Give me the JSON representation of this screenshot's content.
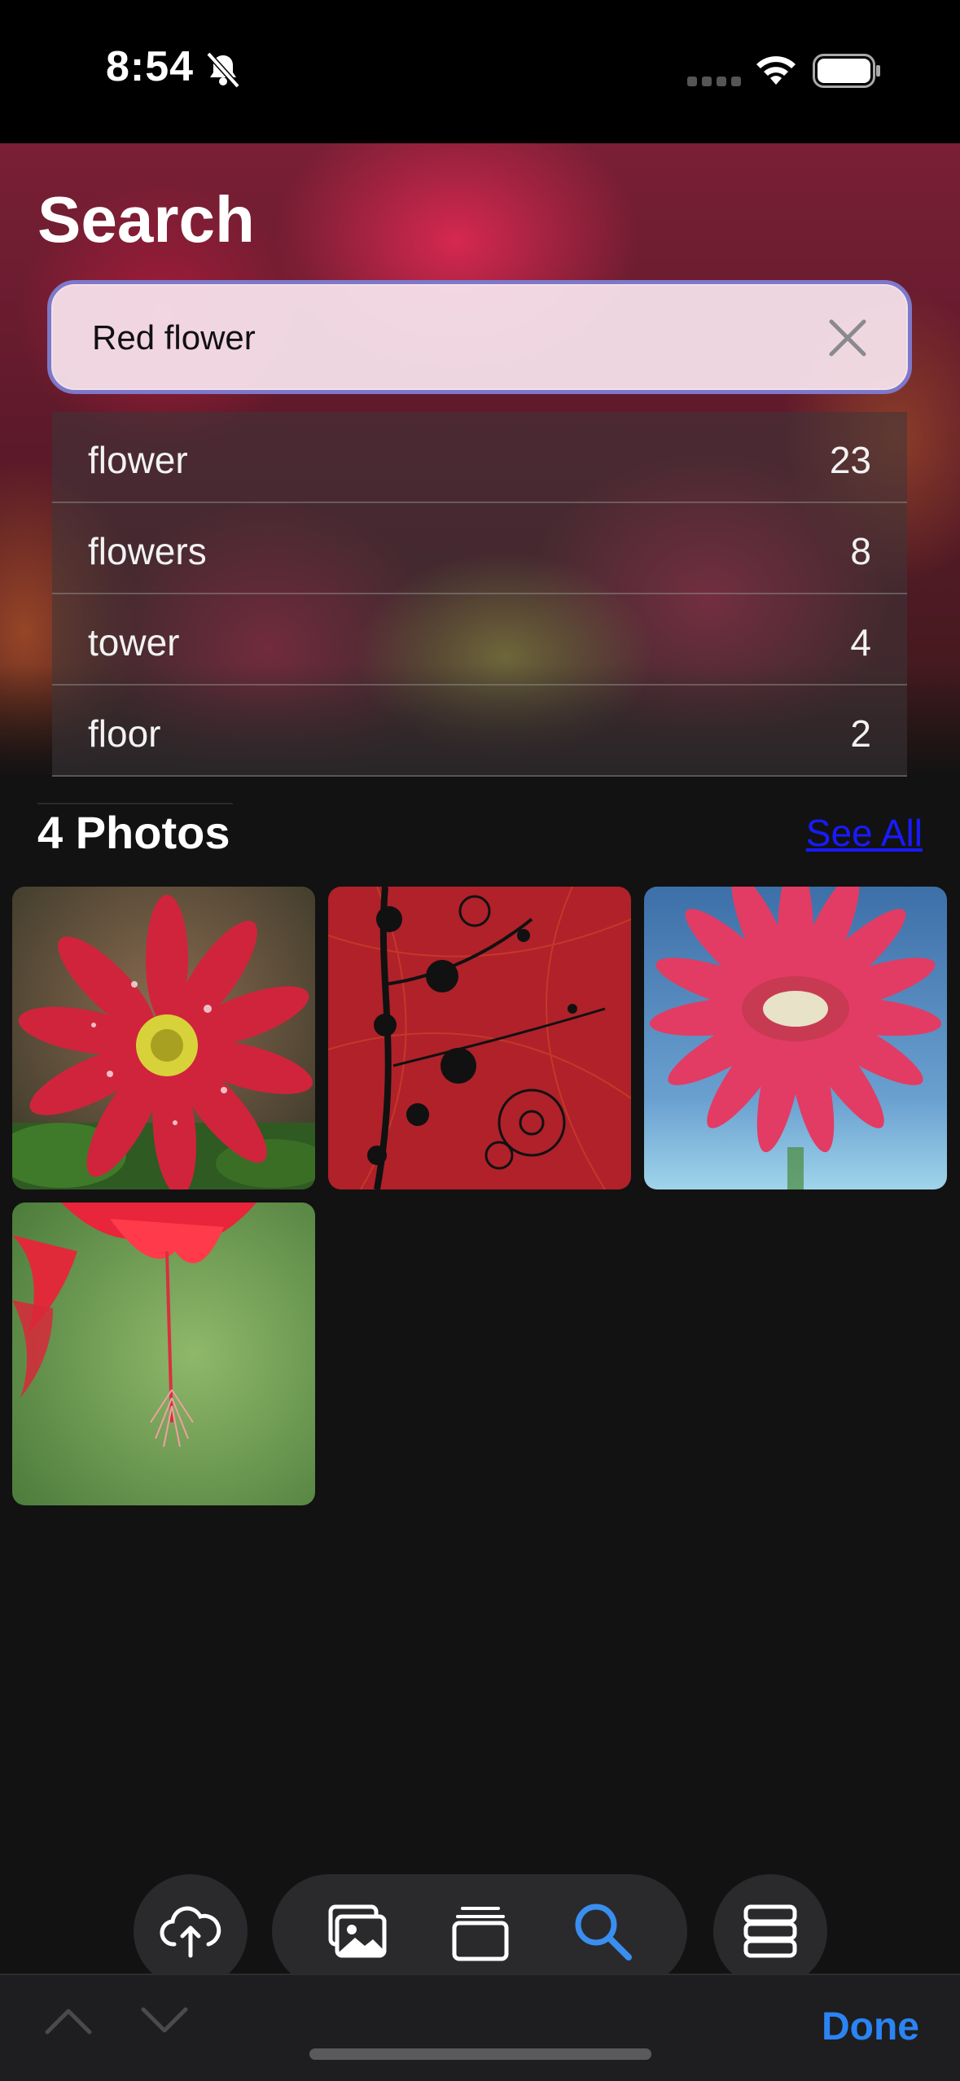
{
  "status_bar": {
    "time": "8:54",
    "icons": [
      "bell-slash-icon",
      "cellular-signal-icon",
      "wifi-icon",
      "battery-icon"
    ]
  },
  "header": {
    "title": "Search"
  },
  "search": {
    "query": "Red flower",
    "clear_icon": "xmark-icon"
  },
  "suggestions": [
    {
      "label": "flower",
      "count": "23"
    },
    {
      "label": "flowers",
      "count": "8"
    },
    {
      "label": "tower",
      "count": "4"
    },
    {
      "label": "floor",
      "count": "2"
    }
  ],
  "results": {
    "title": "4 Photos",
    "see_all": "See All",
    "photos": [
      {
        "subject": "red daisy with water droplets"
      },
      {
        "subject": "red floral silhouette pattern"
      },
      {
        "subject": "pink gerbera on blue"
      },
      {
        "subject": "red hibiscus on green"
      }
    ]
  },
  "tab_bar": {
    "items": [
      "cloud-upload-icon",
      "photos-icon",
      "albums-icon",
      "search-icon",
      "list-icon"
    ],
    "active": "search-icon",
    "active_color": "#3a8ef0"
  },
  "keyboard_toolbar": {
    "done_label": "Done",
    "done_color": "#2a84f4"
  }
}
